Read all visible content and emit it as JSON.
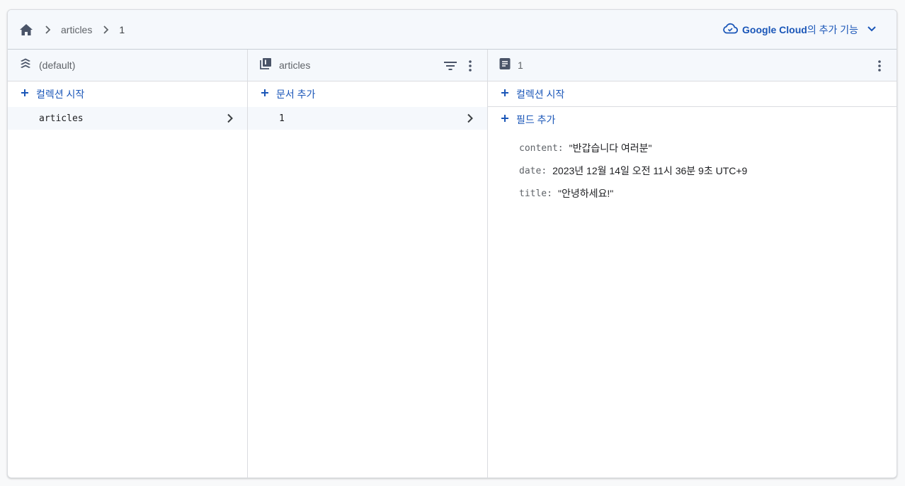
{
  "breadcrumb": {
    "home_icon": "home-icon",
    "items": [
      "articles",
      "1"
    ]
  },
  "google_cloud": {
    "brand": "Google Cloud",
    "suffix": "의 추가 기능",
    "icon": "cloud-icon",
    "expand_icon": "chevron-down-icon"
  },
  "columns": {
    "root": {
      "title": "(default)",
      "icon": "database-stack-icon",
      "add_label": "컬렉션 시작",
      "items": [
        "articles"
      ]
    },
    "collection": {
      "title": "articles",
      "icon": "collection-icon",
      "add_label": "문서 추가",
      "items": [
        "1"
      ]
    },
    "document": {
      "title": "1",
      "icon": "document-icon",
      "add_collection_label": "컬렉션 시작",
      "add_field_label": "필드 추가",
      "fields": [
        {
          "key": "content",
          "value": "\"반갑습니다 여러분\""
        },
        {
          "key": "date",
          "value": "2023년 12월 14일 오전 11시 36분 9초 UTC+9"
        },
        {
          "key": "title",
          "value": "\"안녕하세요!\""
        }
      ]
    }
  },
  "colors": {
    "accent": "#1a56b8",
    "header_bg": "#f5f8fc",
    "border": "#dadce0"
  }
}
